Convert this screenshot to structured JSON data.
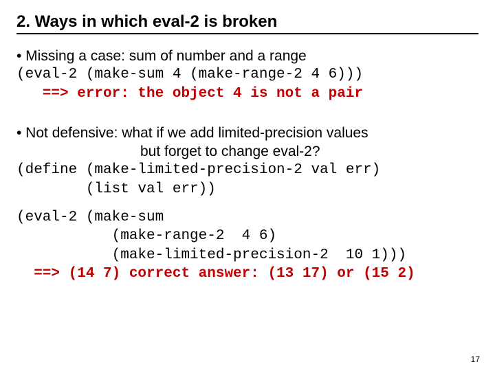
{
  "title": "2. Ways in which eval-2 is broken",
  "bullet1": "• Missing a case: sum of number and a range",
  "code1a": "(eval-2 (make-sum 4 (make-range-2 4 6)))",
  "code1b": "   ==> error: the object 4 is not a pair",
  "bullet2a": "• Not defensive: what if we add limited-precision values",
  "bullet2b": "but forget to change eval-2?",
  "code2a": "(define (make-limited-precision-2 val err)",
  "code2b": "        (list val err))",
  "code3a": "(eval-2 (make-sum",
  "code3b": "           (make-range-2  4 6)",
  "code3c": "           (make-limited-precision-2  10 1)))",
  "code3d": "  ==> (14 7) correct answer: (13 17) or (15 2)",
  "page_number": "17"
}
